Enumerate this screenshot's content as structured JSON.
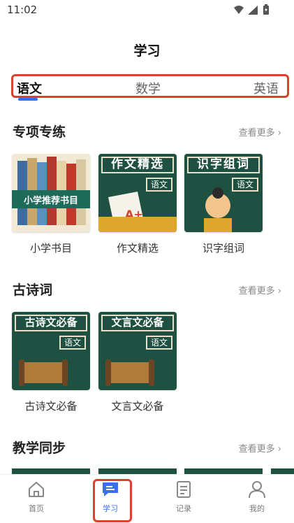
{
  "status_bar": {
    "time": "11:02"
  },
  "page_title": "学习",
  "subject_tabs": [
    "语文",
    "数学",
    "英语"
  ],
  "sections": [
    {
      "title": "专项专练",
      "more": "查看更多",
      "items": [
        {
          "label": "小学书目",
          "thumb_title": "小学推荐书目"
        },
        {
          "label": "作文精选",
          "thumb_title": "作文精选",
          "tag": "语文"
        },
        {
          "label": "识字组词",
          "thumb_title": "识字组词",
          "tag": "语文"
        }
      ]
    },
    {
      "title": "古诗词",
      "more": "查看更多",
      "items": [
        {
          "label": "古诗文必备",
          "thumb_title": "古诗文必备",
          "tag": "语文"
        },
        {
          "label": "文言文必备",
          "thumb_title": "文言文必备",
          "tag": "语文"
        }
      ]
    },
    {
      "title": "教学同步",
      "more": "查看更多"
    }
  ],
  "bottom_nav": [
    {
      "label": "首页",
      "icon": "home-icon"
    },
    {
      "label": "学习",
      "icon": "study-icon"
    },
    {
      "label": "记录",
      "icon": "record-icon"
    },
    {
      "label": "我的",
      "icon": "profile-icon"
    }
  ],
  "colors": {
    "accent": "#3a6ff0",
    "highlight": "#d9432e",
    "chalkboard": "#1f5142",
    "desk": "#e0a72f"
  }
}
